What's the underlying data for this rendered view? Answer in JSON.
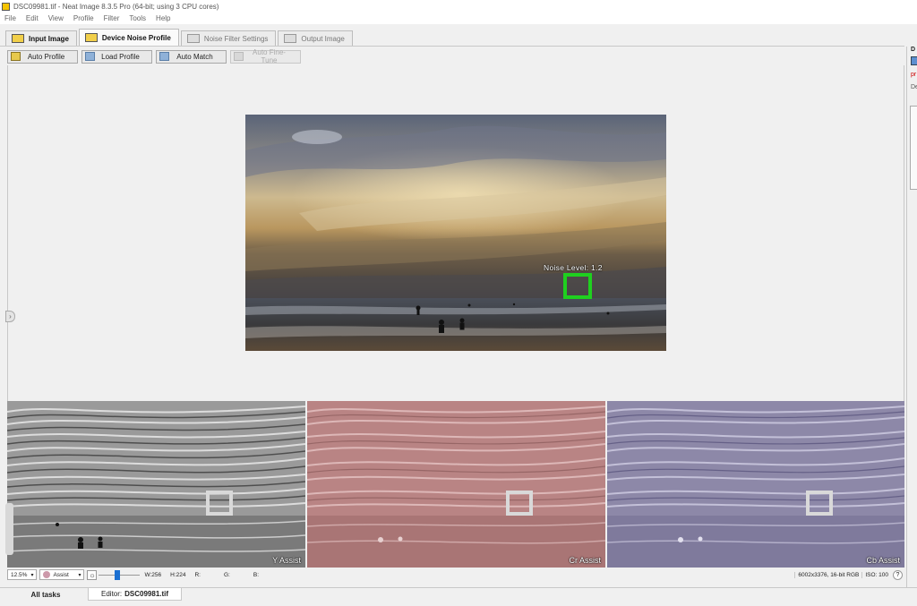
{
  "window": {
    "title": "DSC09981.tif - Neat Image 8.3.5 Pro (64-bit; using 3 CPU cores)"
  },
  "menu": [
    "File",
    "Edit",
    "View",
    "Profile",
    "Filter",
    "Tools",
    "Help"
  ],
  "tabs": [
    {
      "label": "Input Image",
      "active": false,
      "enabled": true
    },
    {
      "label": "Device Noise Profile",
      "active": true,
      "enabled": true
    },
    {
      "label": "Noise Filter Settings",
      "active": false,
      "enabled": false
    },
    {
      "label": "Output Image",
      "active": false,
      "enabled": false
    }
  ],
  "toolbar": {
    "auto_profile": "Auto Profile",
    "load_profile": "Load Profile",
    "auto_match": "Auto Match",
    "auto_fine_tune": "Auto Fine-Tune"
  },
  "preview": {
    "noise_label": "Noise Level: 1.2",
    "marker_color": "#1fd01f"
  },
  "assist_panels": [
    {
      "label": "Y Assist",
      "tint": "#9a9a9a"
    },
    {
      "label": "Cr Assist",
      "tint": "#b98484"
    },
    {
      "label": "Cb Assist",
      "tint": "#8d88a8"
    }
  ],
  "status": {
    "zoom": "12.5%",
    "view_mode": "Assist",
    "brightness_level": 0.45,
    "width": "W:256",
    "height": "H:224",
    "r": "R:",
    "g": "G:",
    "b": "B:",
    "image_info": "6002x3376, 16-bit RGB",
    "iso": "ISO: 100"
  },
  "right_panel": {
    "cut_top": "D",
    "cut_red": "pr",
    "cut_label": "De"
  },
  "bottom_tabs": {
    "all_tasks": "All tasks",
    "editor_prefix": "Editor:",
    "editor_file": "DSC09981.tif"
  },
  "colors": {
    "accent": "#1a6fd1",
    "noise_marker": "#1fd01f"
  }
}
